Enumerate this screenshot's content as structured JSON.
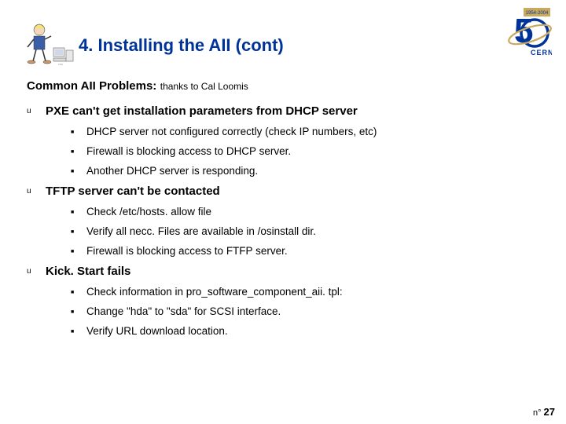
{
  "title": "4. Installing the AII (cont)",
  "subtitle_bold": "Common AII Problems:",
  "subtitle_credit": " thanks to Cal Loomis",
  "sections": [
    {
      "heading": "PXE can't get installation parameters from DHCP server",
      "items": [
        "DHCP server not configured correctly (check IP numbers, etc)",
        "Firewall is blocking access to DHCP server.",
        "Another DHCP server is responding."
      ]
    },
    {
      "heading": "TFTP server can't be contacted",
      "items": [
        "Check /etc/hosts. allow file",
        "Verify all necc. Files are available in /osinstall dir.",
        "Firewall is blocking access to FTFP server."
      ]
    },
    {
      "heading": "Kick. Start fails",
      "items": [
        "Check information in pro_software_component_aii. tpl:",
        "Change \"hda\" to \"sda\" for SCSI interface.",
        "Verify URL download location."
      ]
    }
  ],
  "footer_prefix": "n° ",
  "footer_num": "27",
  "logo_top_text": "1954-2004",
  "logo_big_num": "5",
  "logo_label": "CERN"
}
